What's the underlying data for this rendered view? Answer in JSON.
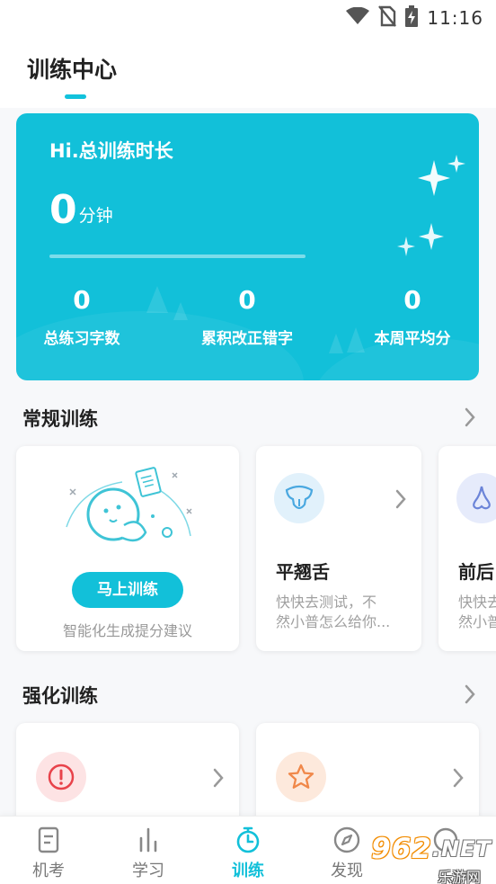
{
  "status_bar": {
    "time": "11:16",
    "icons": [
      "wifi-icon",
      "no-sim-icon",
      "battery-charging-icon"
    ]
  },
  "header": {
    "title": "训练中心"
  },
  "hero": {
    "heading": "Hi.总训练时长",
    "total_value": "0",
    "total_unit": "分钟",
    "progress": 0,
    "stats": [
      {
        "value": "0",
        "label": "总练习字数"
      },
      {
        "value": "0",
        "label": "累积改正错字"
      },
      {
        "value": "0",
        "label": "本周平均分"
      }
    ],
    "accent": "#12c0d9"
  },
  "regular": {
    "title": "常规训练",
    "main_card": {
      "button": "马上训练",
      "subtitle": "智能化生成提分建议"
    },
    "cards": [
      {
        "title": "平翘舌",
        "desc": "快快去测试，不\n然小普怎么给你...",
        "icon": "tongue-icon"
      },
      {
        "title": "前后",
        "desc": "快快去\n然小普",
        "icon": "nose-icon"
      }
    ]
  },
  "intensive": {
    "title": "强化训练",
    "cards": [
      {
        "icon": "alert-icon",
        "color": "#e8434b"
      },
      {
        "icon": "star-icon",
        "color": "#f0884a"
      }
    ]
  },
  "bottom_nav": {
    "items": [
      {
        "label": "机考",
        "icon": "exam-icon"
      },
      {
        "label": "学习",
        "icon": "chart-bars-icon"
      },
      {
        "label": "训练",
        "icon": "stopwatch-icon"
      },
      {
        "label": "发现",
        "icon": "compass-icon"
      },
      {
        "label": "",
        "icon": "profile-icon"
      }
    ],
    "active_index": 2
  },
  "watermark": {
    "logo_num": "962",
    "logo_net": ".NET",
    "sub": "乐游网"
  }
}
